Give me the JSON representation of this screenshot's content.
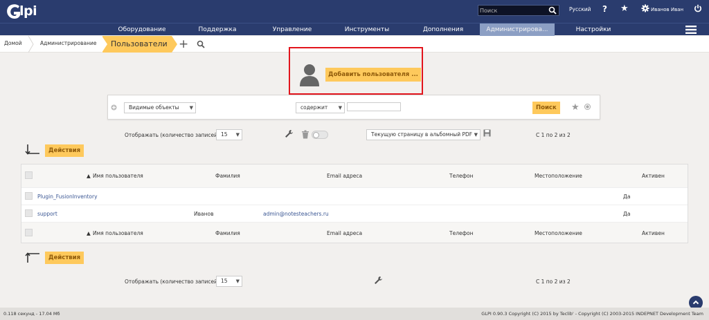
{
  "header": {
    "logo_text": "lpi",
    "search_placeholder": "Поиск",
    "language": "Русский",
    "help_glyph": "?",
    "username": "Иванов Иван",
    "icons": [
      "glpi-logo-icon",
      "search-icon",
      "help-icon",
      "star-icon",
      "gear-icon",
      "power-icon"
    ]
  },
  "menu": {
    "items": [
      {
        "label": "Оборудование"
      },
      {
        "label": "Поддержка"
      },
      {
        "label": "Управление"
      },
      {
        "label": "Инструменты"
      },
      {
        "label": "Дополнения"
      },
      {
        "label": "Администрирова..."
      },
      {
        "label": "Настройки"
      }
    ],
    "active_index": 5
  },
  "breadcrumb": {
    "items": [
      "Домой",
      "Администрирование"
    ],
    "current": "Пользователи"
  },
  "add_user": {
    "label": "Добавить пользователя ..."
  },
  "criteria": {
    "field": "Видимые объекты",
    "operator": "содержит",
    "value": "",
    "search_label": "Поиск"
  },
  "display": {
    "label": "Отображать (количество записей)",
    "count": "15",
    "export_option": "Текущую страницу в альбомный PDF",
    "pagination": "С 1 по 2 из 2"
  },
  "actions_label": "Действия",
  "table": {
    "columns": [
      "Имя пользователя",
      "Фамилия",
      "Email адреса",
      "Телефон",
      "Местоположение",
      "Активен"
    ],
    "sort_marker": "▲",
    "rows": [
      {
        "login": "Plugin_FusionInventory",
        "surname": "",
        "email": "",
        "phone": "",
        "location": "",
        "active": "Да"
      },
      {
        "login": "support",
        "surname": "Иванов",
        "email": "admin@notesteachers.ru",
        "phone": "",
        "location": "",
        "active": "Да"
      }
    ]
  },
  "footer": {
    "timing": "0.118 секунд - 17.04 Мб",
    "copyright": "GLPI 0.90.3 Copyright (C) 2015 by Teclib' - Copyright (C) 2003-2015 INDEPNET Development Team"
  },
  "colors": {
    "header_bg": "#2a3c6e",
    "accent": "#fec95c",
    "active_menu": "#8c9fc4",
    "highlight_border": "#e2141c",
    "link": "#3a5693"
  }
}
